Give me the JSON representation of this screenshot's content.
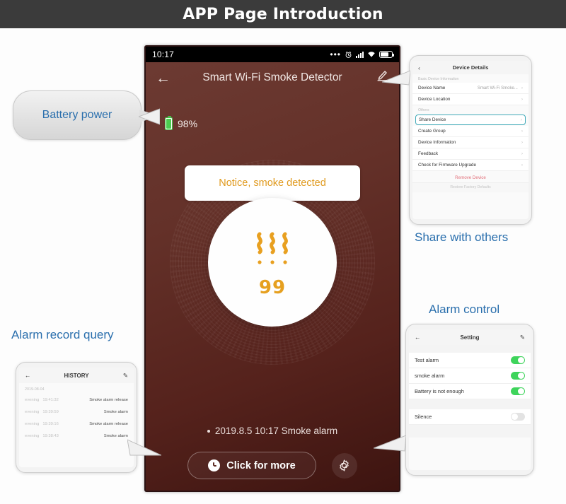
{
  "titlebar": {
    "title": "APP Page Introduction"
  },
  "phone": {
    "status": {
      "time": "10:17",
      "dots": "•••",
      "alarm_icon": "alarm-clock-icon",
      "signal_icon": "signal-bars-icon",
      "wifi_icon": "wifi-icon",
      "battery_icon": "battery-icon"
    },
    "appbar": {
      "back_icon": "←",
      "title": "Smart Wi-Fi Smoke Detector",
      "edit_icon": "✎"
    },
    "battery": {
      "level": "98%",
      "icon": "battery-icon"
    },
    "notice": "Notice, smoke detected",
    "circle": {
      "smoke_icon": "smoke-waves-icon",
      "value": "99"
    },
    "alarm_line": "2019.8.5 10:17 Smoke alarm",
    "click_more": {
      "label": "Click for more",
      "icon": "clock-icon"
    },
    "gear": {
      "icon": "gear-icon"
    }
  },
  "callouts": {
    "battery_power": "Battery power",
    "alarm_record_query": "Alarm record query",
    "share_with_others": "Share with others",
    "alarm_control": "Alarm control"
  },
  "device_details": {
    "back_icon": "‹",
    "title": "Device Details",
    "section1": "Basic Device Information",
    "section2": "Others",
    "rows": [
      {
        "label": "Device Name",
        "value": "Smart Wi-Fi Smoke...",
        "chev": "›"
      },
      {
        "label": "Device Location",
        "value": "",
        "chev": "›"
      },
      {
        "label": "Share Device",
        "value": "",
        "chev": "›"
      },
      {
        "label": "Create Group",
        "value": "",
        "chev": "›"
      },
      {
        "label": "Device Information",
        "value": "",
        "chev": "›"
      },
      {
        "label": "Feedback",
        "value": "",
        "chev": "›"
      },
      {
        "label": "Check for Firmware Upgrade",
        "value": "",
        "chev": "›"
      }
    ],
    "remove_device": "Remove Device",
    "restore_defaults": "Restore Factory Defaults"
  },
  "setting": {
    "back_icon": "←",
    "title": "Setting",
    "edit_icon": "✎",
    "rows": [
      {
        "label": "Test alarm",
        "state": "on"
      },
      {
        "label": "smoke alarm",
        "state": "on"
      },
      {
        "label": "Battery is not enough",
        "state": "on"
      },
      {
        "label": "Silence",
        "state": "off"
      }
    ]
  },
  "history": {
    "back_icon": "←",
    "title": "HISTORY",
    "edit_icon": "✎",
    "date": "2019-08-04",
    "rows": [
      {
        "period": "evening",
        "time": "19:41:32",
        "event": "Smoke alarm release"
      },
      {
        "period": "evening",
        "time": "19:39:59",
        "event": "Smoke alarm"
      },
      {
        "period": "evening",
        "time": "19:39:16",
        "event": "Smoke alarm release"
      },
      {
        "period": "evening",
        "time": "19:38:43",
        "event": "Smoke alarm"
      }
    ]
  },
  "colors": {
    "accent_blue": "#2a6fad",
    "amber": "#e09a1e",
    "phone_bg": "#5d2b23",
    "toggle_on": "#3ed45b",
    "danger": "#e2707a"
  }
}
